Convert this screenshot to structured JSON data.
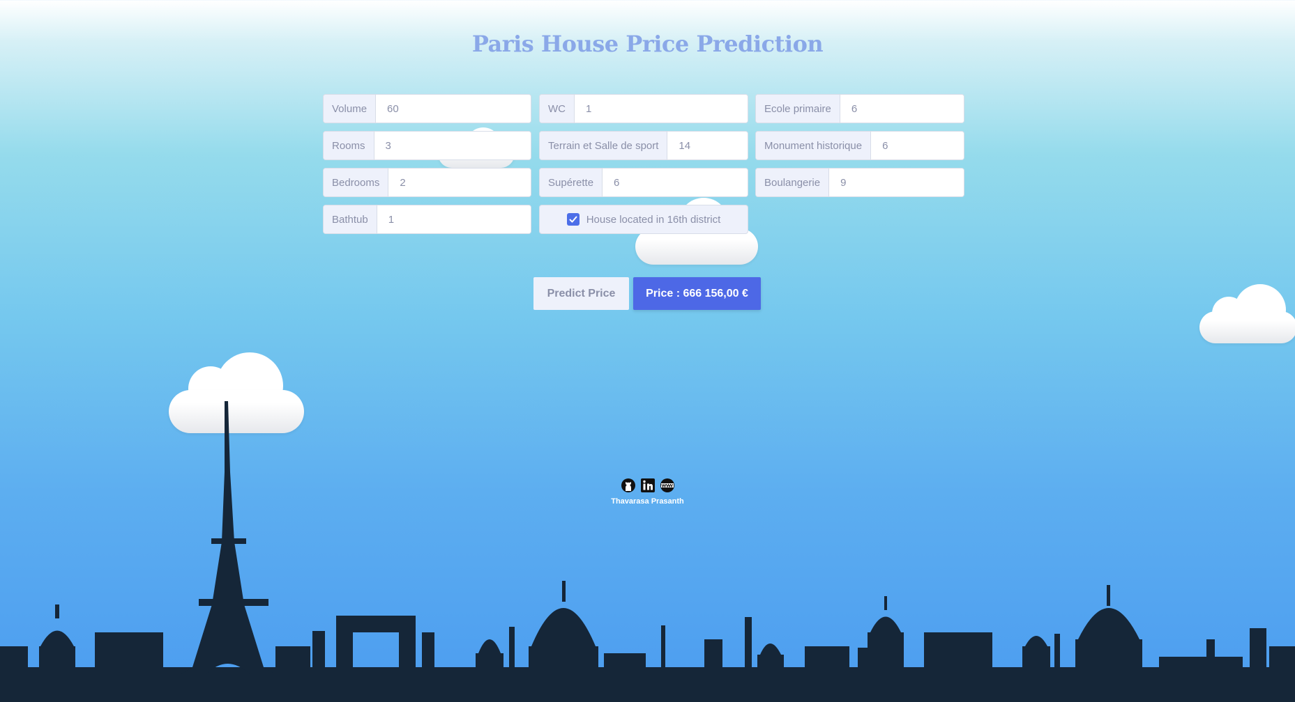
{
  "page": {
    "title": "Paris House Price Prediction"
  },
  "form": {
    "fields": [
      {
        "id": "volume",
        "label": "Volume",
        "value": "60"
      },
      {
        "id": "rooms",
        "label": "Rooms",
        "value": "3"
      },
      {
        "id": "bedrooms",
        "label": "Bedrooms",
        "value": "2"
      },
      {
        "id": "bathtub",
        "label": "Bathtub",
        "value": "1"
      },
      {
        "id": "wc",
        "label": "WC",
        "value": "1"
      },
      {
        "id": "terrain",
        "label": "Terrain et Salle de sport",
        "value": "14"
      },
      {
        "id": "superette",
        "label": "Supérette",
        "value": "6"
      },
      {
        "id": "ecole",
        "label": "Ecole primaire",
        "value": "6"
      },
      {
        "id": "monument",
        "label": "Monument historique",
        "value": "6"
      },
      {
        "id": "boulangerie",
        "label": "Boulangerie",
        "value": "9"
      }
    ],
    "district_checkbox": {
      "label": "House located in 16th district",
      "checked": true
    }
  },
  "actions": {
    "predict_label": "Predict Price",
    "price_label": "Price : 666 156,00 €"
  },
  "footer": {
    "icons": [
      "github-icon",
      "linkedin-icon",
      "website-icon"
    ],
    "author": "Thavarasa Prasanth"
  },
  "colors": {
    "accent": "#4d68e6",
    "title": "#8aa8e8",
    "skyline": "#152638"
  }
}
